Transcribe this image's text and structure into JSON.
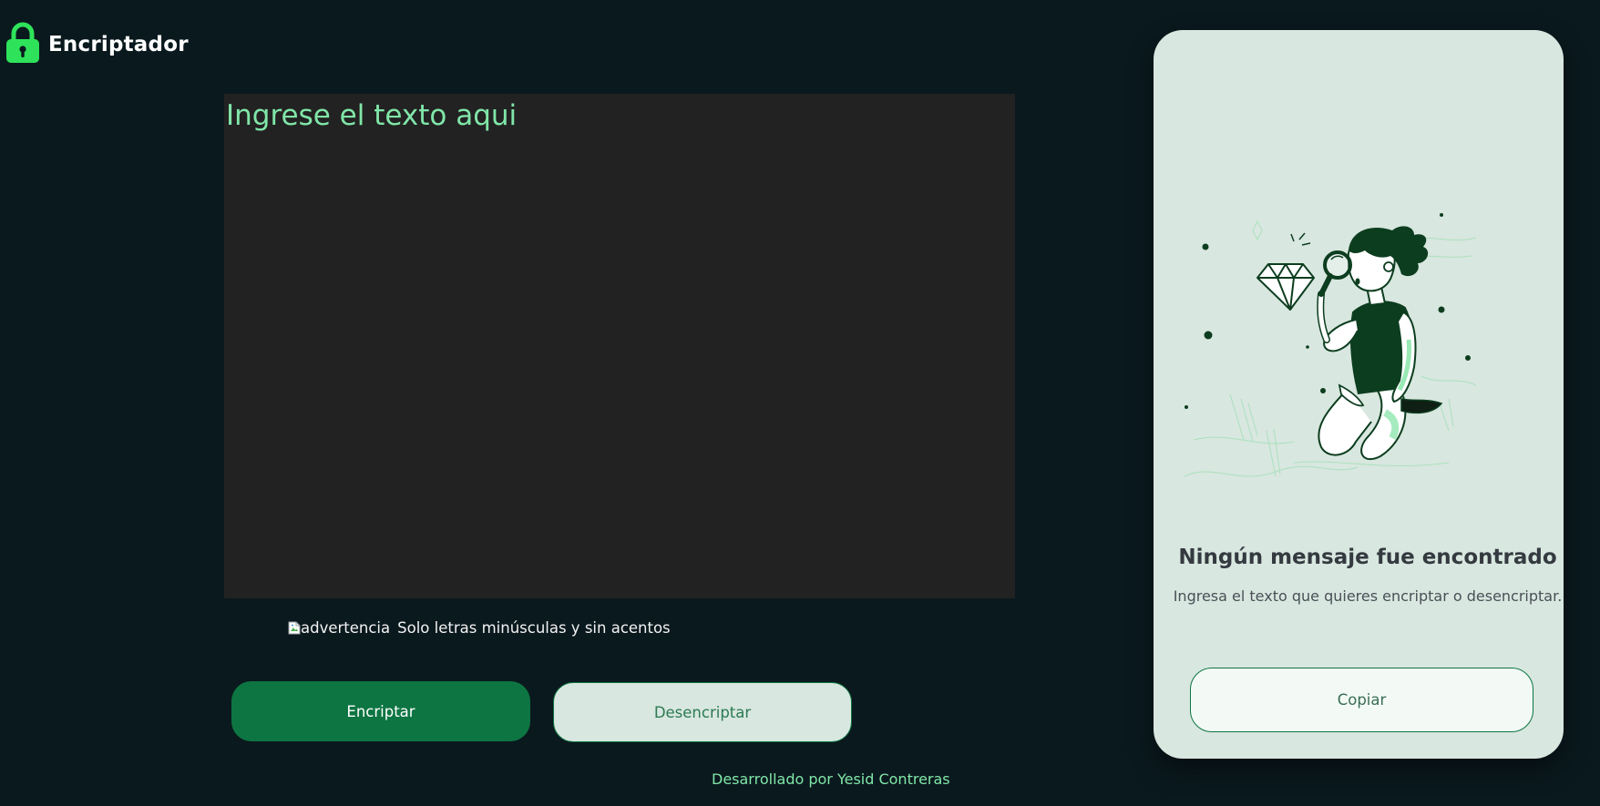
{
  "header": {
    "logo_icon": "lock-icon",
    "title": "Encriptador",
    "accent_color": "#2ee35a"
  },
  "editor": {
    "placeholder": "Ingrese el texto aqui",
    "value": ""
  },
  "warning": {
    "icon_alt": "advertencia",
    "message": "Solo letras minúsculas y sin acentos"
  },
  "actions": {
    "encrypt_label": "Encriptar",
    "decrypt_label": "Desencriptar"
  },
  "footer": {
    "credit": "Desarrollado por Yesid Contreras"
  },
  "output_panel": {
    "illustration": "person-magnifying-glass-diamond-illustration",
    "title": "Ningún mensaje fue encontrado",
    "subtitle": "Ingresa el texto que quieres encriptar o desencriptar.",
    "copy_label": "Copiar"
  },
  "colors": {
    "background": "#0a191e",
    "primary": "#0d7542",
    "highlight": "#80e6a8",
    "panel": "#d8e7df"
  }
}
